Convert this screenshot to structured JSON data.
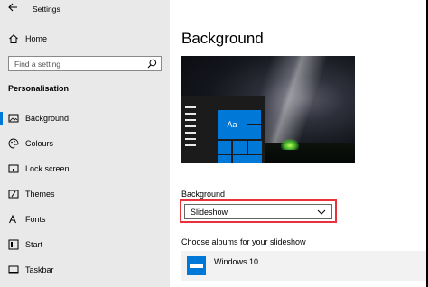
{
  "window": {
    "title": "Settings"
  },
  "sidebar": {
    "home_label": "Home",
    "search_placeholder": "Find a setting",
    "section_title": "Personalisation",
    "items": [
      {
        "label": "Background",
        "icon": "picture-icon",
        "active": true
      },
      {
        "label": "Colours",
        "icon": "palette-icon",
        "active": false
      },
      {
        "label": "Lock screen",
        "icon": "lock-screen-icon",
        "active": false
      },
      {
        "label": "Themes",
        "icon": "themes-icon",
        "active": false
      },
      {
        "label": "Fonts",
        "icon": "fonts-icon",
        "active": false
      },
      {
        "label": "Start",
        "icon": "start-icon",
        "active": false
      },
      {
        "label": "Taskbar",
        "icon": "taskbar-icon",
        "active": false
      }
    ]
  },
  "main": {
    "title": "Background",
    "preview": {
      "tile_text": "Aa"
    },
    "background_field": {
      "label": "Background",
      "value": "Slideshow"
    },
    "albums_label": "Choose albums for your slideshow",
    "album": {
      "name": "Windows 10"
    }
  },
  "colors": {
    "accent": "#0078d7",
    "highlight_box": "#e8313a",
    "sidebar_bg": "#e9e9e9"
  }
}
